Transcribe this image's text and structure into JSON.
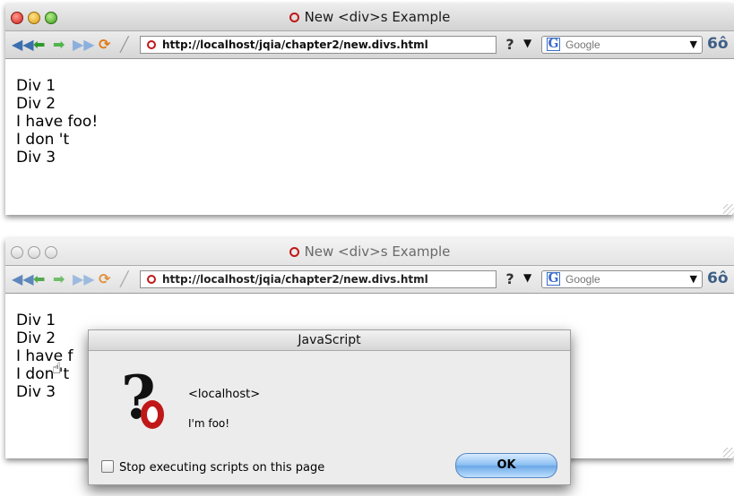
{
  "colors": {
    "close": "#d0201a",
    "minimize": "#d99a10",
    "zoom": "#3c9a1c",
    "ok_button": "#87bdf2",
    "opera_red": "#c01818"
  },
  "icons": {
    "toolbar": [
      "rewind-icon",
      "back-arrow-icon",
      "forward-arrow-icon",
      "fast-forward-icon",
      "reload-icon",
      "edit-pencil-icon"
    ],
    "search": "google-g-icon",
    "binoculars": "binoculars-icon"
  },
  "glyphs": {
    "rewind": "◀◀",
    "back": "⬅",
    "forward": "➡",
    "fast_forward": "▶▶",
    "reload": "⟳",
    "edit": "╱",
    "help": "?",
    "dropdown": "▼",
    "google_g": "G",
    "binoculars": "6ô",
    "question": "?",
    "pointer": "☝"
  },
  "window1": {
    "title": "New <div>s Example",
    "url": "http://localhost/jqia/chapter2/new.divs.html",
    "search_placeholder": "Google",
    "lines": [
      "Div 1",
      "Div 2",
      "I have foo!",
      "I don 't",
      "Div 3"
    ]
  },
  "window2": {
    "title": "New <div>s Example",
    "url": "http://localhost/jqia/chapter2/new.divs.html",
    "search_placeholder": "Google",
    "lines": [
      "Div 1",
      "Div 2",
      "I have f",
      "I don 't",
      "Div 3"
    ]
  },
  "dialog": {
    "title": "JavaScript",
    "host": "<localhost>",
    "message": "I'm foo!",
    "checkbox_label": "Stop executing scripts on this page",
    "ok_label": "OK"
  }
}
